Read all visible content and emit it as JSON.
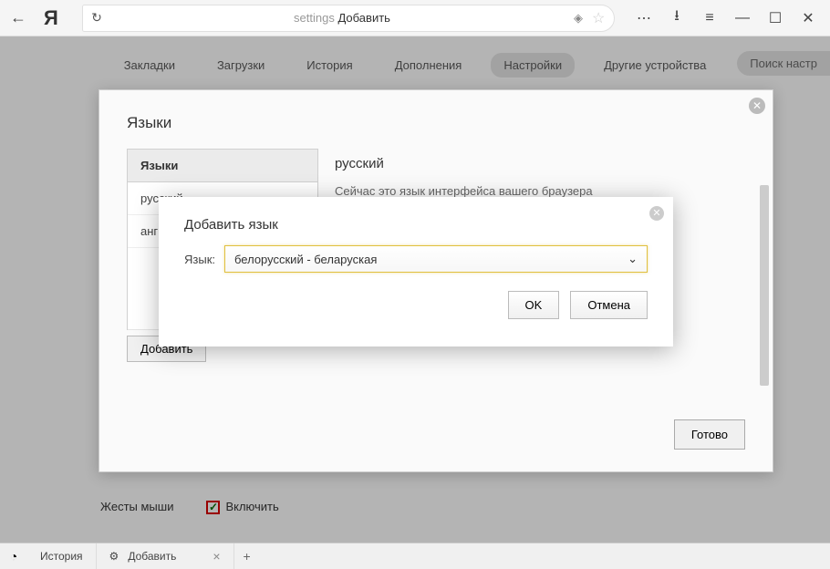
{
  "titlebar": {
    "url_prefix": "settings",
    "url_page": "Добавить"
  },
  "nav": {
    "tabs": [
      "Закладки",
      "Загрузки",
      "История",
      "Дополнения",
      "Настройки",
      "Другие устройства"
    ],
    "active_index": 4,
    "search_placeholder": "Поиск настр"
  },
  "lang_modal": {
    "title": "Языки",
    "side_header": "Языки",
    "side_items": [
      "русский",
      "анг"
    ],
    "main_title": "русский",
    "main_desc": "Сейчас это язык интерфейса вашего браузера",
    "add_button": "Добавить",
    "done_button": "Готово"
  },
  "add_dialog": {
    "title": "Добавить язык",
    "label": "Язык:",
    "selected": "белорусский - беларуская",
    "ok": "OK",
    "cancel": "Отмена"
  },
  "gestures": {
    "label": "Жесты мыши",
    "checkbox_label": "Включить"
  },
  "taskbar": {
    "items": [
      {
        "icon": "",
        "label": "История"
      },
      {
        "icon": "⚙",
        "label": "Добавить"
      }
    ]
  }
}
